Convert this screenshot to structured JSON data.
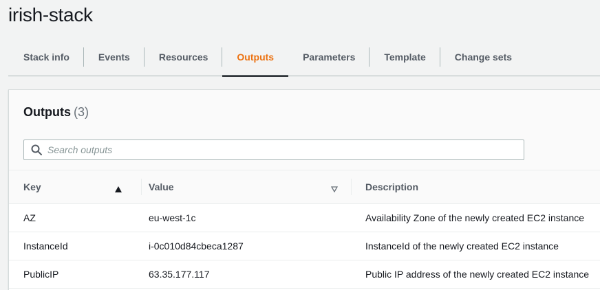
{
  "stack": {
    "title": "irish-stack"
  },
  "tabs": [
    {
      "label": "Stack info",
      "active": false
    },
    {
      "label": "Events",
      "active": false
    },
    {
      "label": "Resources",
      "active": false
    },
    {
      "label": "Outputs",
      "active": true
    },
    {
      "label": "Parameters",
      "active": false
    },
    {
      "label": "Template",
      "active": false
    },
    {
      "label": "Change sets",
      "active": false
    }
  ],
  "outputs": {
    "title": "Outputs",
    "count": "(3)",
    "search": {
      "placeholder": "Search outputs",
      "value": ""
    },
    "columns": {
      "key": "Key",
      "value": "Value",
      "description": "Description"
    },
    "rows": [
      {
        "key": "AZ",
        "value": "eu-west-1c",
        "description": "Availability Zone of the newly created EC2 instance"
      },
      {
        "key": "InstanceId",
        "value": "i-0c010d84cbeca1287",
        "description": "InstanceId of the newly created EC2 instance"
      },
      {
        "key": "PublicIP",
        "value": "63.35.177.117",
        "description": "Public IP address of the newly created EC2 instance"
      }
    ]
  },
  "colors": {
    "accent": "#ec7211",
    "text": "#16191f",
    "muted": "#545b64",
    "border": "#aab7b8"
  },
  "icons": {
    "search": "search-icon",
    "sort_asc": "sort-ascending-icon",
    "sort_none": "sort-descending-outline-icon"
  }
}
